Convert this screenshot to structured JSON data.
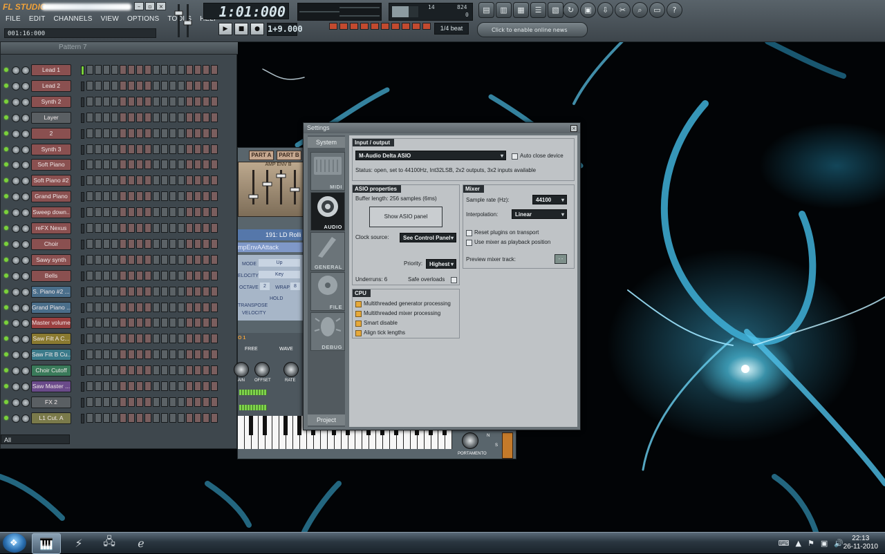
{
  "app": {
    "logo": "FL STUDIO",
    "menu": [
      "FILE",
      "EDIT",
      "CHANNELS",
      "VIEW",
      "OPTIONS",
      "TOOLS",
      "HELP"
    ],
    "hint_time": "001:16:000",
    "song_time": "1:01:000",
    "song_time_dim": "000",
    "tempo": "1+9.000",
    "snap": "1/4 beat",
    "news": "Click to enable online news",
    "cpu_values": [
      "14",
      "824",
      "0"
    ],
    "transport": [
      "play",
      "stop",
      "record"
    ],
    "tool_icons": [
      "playlist-icon",
      "piano-roll-icon",
      "channels-icon",
      "mixer-icon",
      "browser-icon"
    ],
    "help_icons": [
      "undo-icon",
      "save-icon",
      "export-icon",
      "plugin-icon",
      "search-icon",
      "notes-icon",
      "help-icon"
    ]
  },
  "step_sequencer": {
    "pattern": "Pattern 7",
    "filter": "All",
    "channels": [
      {
        "name": "Lead 1",
        "color": "#8a5050"
      },
      {
        "name": "Lead 2",
        "color": "#8a5050"
      },
      {
        "name": "Synth 2",
        "color": "#8a5050"
      },
      {
        "name": "Layer",
        "color": "#5a5f63"
      },
      {
        "name": "2",
        "color": "#8a5050"
      },
      {
        "name": "Synth 3",
        "color": "#8a5050"
      },
      {
        "name": "Soft Piano",
        "color": "#8a5050"
      },
      {
        "name": "Soft Piano #2",
        "color": "#8a5050"
      },
      {
        "name": "Grand Piano",
        "color": "#8a5050"
      },
      {
        "name": "Sweep down..",
        "color": "#8a5050"
      },
      {
        "name": "reFX Nexus",
        "color": "#8a5050"
      },
      {
        "name": "Choir",
        "color": "#8a5050"
      },
      {
        "name": "Sawy synth",
        "color": "#8a5050"
      },
      {
        "name": "Bells",
        "color": "#8a5050"
      },
      {
        "name": "S. Piano #2 ...",
        "color": "#4a6e8a"
      },
      {
        "name": "Grand Piano ...",
        "color": "#4a6e8a"
      },
      {
        "name": "Master volume",
        "color": "#9a4040"
      },
      {
        "name": "Saw Filt A C...",
        "color": "#8a7a30"
      },
      {
        "name": "Saw Filt B Cu...",
        "color": "#3a7a8a"
      },
      {
        "name": "Choir Cutoff",
        "color": "#3a7a5a"
      },
      {
        "name": "Saw Master ...",
        "color": "#6a4a8a"
      },
      {
        "name": "FX 2",
        "color": "#5a5f63"
      },
      {
        "name": "L1 Cut. A",
        "color": "#7a7a4a"
      }
    ]
  },
  "synth": {
    "parts": [
      "PART A",
      "PART B"
    ],
    "amp_env": "AMP ENV B",
    "preset": "191: LD Rolli",
    "env_name": "mpEnvAAttack",
    "mode_label": "MODE",
    "mode_value": "Up",
    "velocity_label": "ELOCITY",
    "velocity_value": "Key",
    "octave_label": "OCTAVE",
    "octave_value": "2",
    "wrap_label": "WRAP",
    "wrap_value": "8",
    "hold_label": "HOLD",
    "transpose_label": "TRANSPOSE",
    "vel_row_label": "VELOCITY",
    "free_label": "FREE",
    "wave_label": "WAVE",
    "osc_label": "O 1",
    "knob_labels": [
      "AIN",
      "OFFSET",
      "RATE"
    ],
    "portamento": "PORTAMENTO",
    "switch_labels": [
      "N",
      "S"
    ]
  },
  "settings": {
    "title": "Settings",
    "tabs": {
      "system": "System",
      "project": "Project"
    },
    "categories": [
      "MIDI",
      "AUDIO",
      "GENERAL",
      "FILE",
      "DEBUG"
    ],
    "active_category": "AUDIO",
    "io": {
      "title": "Input / output",
      "device": "M-Audio Delta ASIO",
      "auto_close_label": "Auto close device",
      "auto_close": false,
      "status": "Status: open, set to 44100Hz, Int32LSB, 2x2 outputs, 3x2 inputs available"
    },
    "asio": {
      "title": "ASIO properties",
      "buffer": "Buffer length: 256 samples (6ms)",
      "show_panel": "Show ASIO panel",
      "clock_label": "Clock source:",
      "clock_value": "See Control Panel",
      "priority_label": "Priority:",
      "priority_value": "Highest",
      "underruns": "Underruns: 6",
      "safe_label": "Safe overloads",
      "safe": false
    },
    "mixer": {
      "title": "Mixer",
      "rate_label": "Sample rate (Hz):",
      "rate_value": "44100",
      "interp_label": "Interpolation:",
      "interp_value": "Linear",
      "reset_label": "Reset plugins on transport",
      "reset": false,
      "use_mixer_label": "Use mixer as playback position",
      "use_mixer": false,
      "preview_label": "Preview mixer track:",
      "preview_value": "--"
    },
    "cpu": {
      "title": "CPU",
      "options": [
        {
          "label": "Multithreaded generator processing",
          "checked": true
        },
        {
          "label": "Multithreaded mixer processing",
          "checked": true
        },
        {
          "label": "Smart disable",
          "checked": true
        },
        {
          "label": "Align tick lengths",
          "checked": true
        }
      ]
    }
  },
  "taskbar": {
    "apps": [
      "fl-studio-icon",
      "winamp-icon",
      "network-icon",
      "internet-explorer-icon"
    ],
    "tray": [
      "keyboard-icon",
      "arrow-up-icon",
      "flag-icon",
      "network-icon",
      "volume-icon"
    ],
    "time": "22:13",
    "date": "26-11-2010"
  }
}
